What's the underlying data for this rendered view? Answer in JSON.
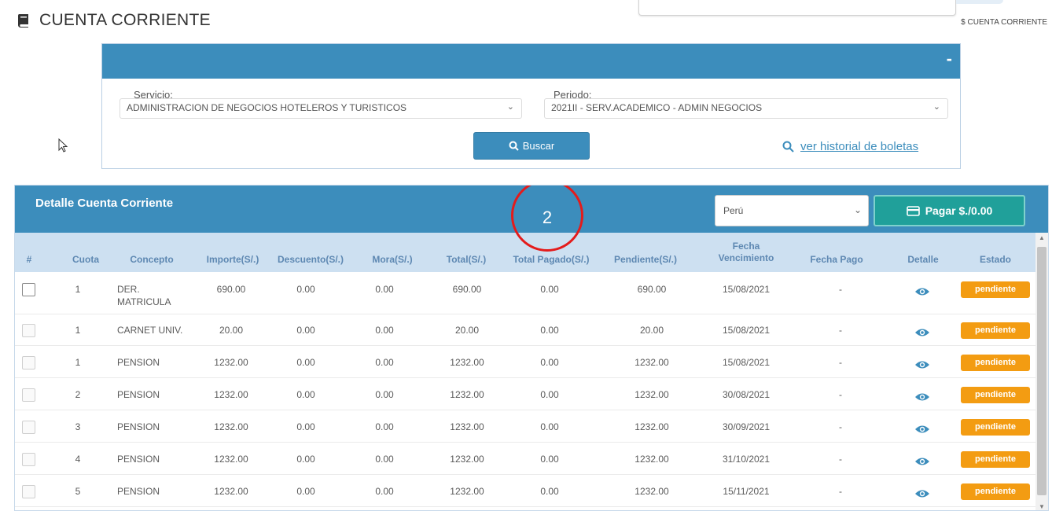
{
  "header": {
    "title": "CUENTA CORRIENTE",
    "breadcrumb": "$ CUENTA CORRIENTE"
  },
  "filters": {
    "collapse_label": "-",
    "servicio": {
      "label": "Servicio:",
      "value": "ADMINISTRACION DE NEGOCIOS HOTELEROS Y TURISTICOS"
    },
    "periodo": {
      "label": "Periodo:",
      "value": "2021II - SERV.ACADEMICO - ADMIN NEGOCIOS"
    },
    "buscar_label": "Buscar",
    "historial_label": "ver historial de boletas"
  },
  "detail": {
    "title": "Detalle Cuenta Corriente",
    "country": "Perú",
    "pagar_label": "Pagar $./0.00",
    "marker_number": "2",
    "columns": [
      "#",
      "Cuota",
      "Concepto",
      "Importe(S/.)",
      "Descuento(S/.)",
      "Mora(S/.)",
      "Total(S/.)",
      "Total Pagado(S/.)",
      "Pendiente(S/.)",
      "Fecha Vencimiento",
      "Fecha Pago",
      "Detalle",
      "Estado"
    ],
    "rows": [
      {
        "cuota": "1",
        "concepto": "DER. MATRICULA",
        "importe": "690.00",
        "descuento": "0.00",
        "mora": "0.00",
        "total": "690.00",
        "pagado": "0.00",
        "pendiente": "690.00",
        "vencimiento": "15/08/2021",
        "fecha_pago": "-",
        "estado": "pendiente"
      },
      {
        "cuota": "1",
        "concepto": "CARNET UNIV.",
        "importe": "20.00",
        "descuento": "0.00",
        "mora": "0.00",
        "total": "20.00",
        "pagado": "0.00",
        "pendiente": "20.00",
        "vencimiento": "15/08/2021",
        "fecha_pago": "-",
        "estado": "pendiente"
      },
      {
        "cuota": "1",
        "concepto": "PENSION",
        "importe": "1232.00",
        "descuento": "0.00",
        "mora": "0.00",
        "total": "1232.00",
        "pagado": "0.00",
        "pendiente": "1232.00",
        "vencimiento": "15/08/2021",
        "fecha_pago": "-",
        "estado": "pendiente"
      },
      {
        "cuota": "2",
        "concepto": "PENSION",
        "importe": "1232.00",
        "descuento": "0.00",
        "mora": "0.00",
        "total": "1232.00",
        "pagado": "0.00",
        "pendiente": "1232.00",
        "vencimiento": "30/08/2021",
        "fecha_pago": "-",
        "estado": "pendiente"
      },
      {
        "cuota": "3",
        "concepto": "PENSION",
        "importe": "1232.00",
        "descuento": "0.00",
        "mora": "0.00",
        "total": "1232.00",
        "pagado": "0.00",
        "pendiente": "1232.00",
        "vencimiento": "30/09/2021",
        "fecha_pago": "-",
        "estado": "pendiente"
      },
      {
        "cuota": "4",
        "concepto": "PENSION",
        "importe": "1232.00",
        "descuento": "0.00",
        "mora": "0.00",
        "total": "1232.00",
        "pagado": "0.00",
        "pendiente": "1232.00",
        "vencimiento": "31/10/2021",
        "fecha_pago": "-",
        "estado": "pendiente"
      },
      {
        "cuota": "5",
        "concepto": "PENSION",
        "importe": "1232.00",
        "descuento": "0.00",
        "mora": "0.00",
        "total": "1232.00",
        "pagado": "0.00",
        "pendiente": "1232.00",
        "vencimiento": "15/11/2021",
        "fecha_pago": "-",
        "estado": "pendiente"
      }
    ]
  },
  "colors": {
    "primary": "#3c8dbc",
    "teal": "#20a09a",
    "warning": "#f39c12",
    "marker": "#e41b1b",
    "table_header": "#cde0f1"
  }
}
